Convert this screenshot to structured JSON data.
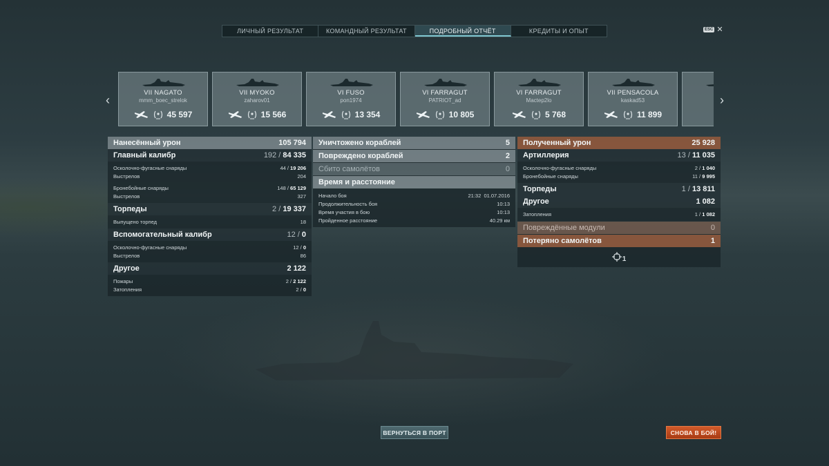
{
  "tabs": [
    {
      "label": "ЛИЧНЫЙ РЕЗУЛЬТАТ",
      "active": false
    },
    {
      "label": "КОМАНДНЫЙ РЕЗУЛЬТАТ",
      "active": false
    },
    {
      "label": "ПОДРОБНЫЙ ОТЧЁТ",
      "active": true
    },
    {
      "label": "КРЕДИТЫ И ОПЫТ",
      "active": false
    }
  ],
  "esc_label": "ESC",
  "cards": [
    {
      "ship": "VII NAGATO",
      "player": "mmm_boec_strelok",
      "score": "45 597"
    },
    {
      "ship": "VII MYOKO",
      "player": "zaharov01",
      "score": "15 566"
    },
    {
      "ship": "VI FUSO",
      "player": "pon1974",
      "score": "13 354"
    },
    {
      "ship": "VI FARRAGUT",
      "player": "PATRIOT_ad",
      "score": "10 805"
    },
    {
      "ship": "VI FARRAGUT",
      "player": "Mactep2lo",
      "score": "5 768"
    },
    {
      "ship": "VII PENSACOLA",
      "player": "kaskad53",
      "score": "11 899"
    },
    {
      "ship": "VI",
      "player": "",
      "score": ""
    }
  ],
  "left": {
    "damage_dealt": {
      "label": "Нанесённый урон",
      "value": "105 794"
    },
    "main_battery": {
      "label": "Главный калибр",
      "hits": "192",
      "value": "84 335"
    },
    "he_shells": {
      "label": "Осколочно-фугасные снаряды",
      "hits": "44",
      "value": "19 206"
    },
    "he_shots": {
      "label": "Выстрелов",
      "value": "204"
    },
    "ap_shells": {
      "label": "Бронебойные снаряды",
      "hits": "148",
      "value": "65 129"
    },
    "ap_shots": {
      "label": "Выстрелов",
      "value": "327"
    },
    "torpedoes": {
      "label": "Торпеды",
      "hits": "2",
      "value": "19 337"
    },
    "torps_launched": {
      "label": "Выпущено торпед",
      "value": "18"
    },
    "secondary": {
      "label": "Вспомогательный калибр",
      "hits": "12",
      "value": "0"
    },
    "sec_he": {
      "label": "Осколочно-фугасные снаряды",
      "hits": "12",
      "value": "0"
    },
    "sec_shots": {
      "label": "Выстрелов",
      "value": "86"
    },
    "other": {
      "label": "Другое",
      "value": "2 122"
    },
    "fires": {
      "label": "Пожары",
      "hits": "2",
      "value": "2 122"
    },
    "floods": {
      "label": "Затопления",
      "hits": "2",
      "value": "0"
    }
  },
  "center": {
    "destroyed": {
      "label": "Уничтожено кораблей",
      "value": "5"
    },
    "damaged": {
      "label": "Повреждено кораблей",
      "value": "2"
    },
    "planes": {
      "label": "Сбито самолётов",
      "value": "0"
    },
    "time_header": "Время и расстояние",
    "battle_start": {
      "label": "Начало боя",
      "time": "21:32",
      "date": "01.07.2016"
    },
    "duration": {
      "label": "Продолжительность боя",
      "value": "10:13"
    },
    "participation": {
      "label": "Время участия в бою",
      "value": "10:13"
    },
    "distance": {
      "label": "Пройденное расстояние",
      "value": "40.29 км"
    }
  },
  "right": {
    "damage_received": {
      "label": "Полученный урон",
      "value": "25 928"
    },
    "artillery": {
      "label": "Артиллерия",
      "hits": "13",
      "value": "11 035"
    },
    "he_shells": {
      "label": "Осколочно-фугасные снаряды",
      "hits": "2",
      "value": "1 040"
    },
    "ap_shells": {
      "label": "Бронебойные снаряды",
      "hits": "11",
      "value": "9 995"
    },
    "torpedoes": {
      "label": "Торпеды",
      "hits": "1",
      "value": "13 811"
    },
    "other": {
      "label": "Другое",
      "value": "1 082"
    },
    "floods": {
      "label": "Затопления",
      "hits": "1",
      "value": "1 082"
    },
    "modules": {
      "label": "Повреждённые модули",
      "value": "0"
    },
    "planes_lost": {
      "label": "Потеряно самолётов",
      "value": "1"
    },
    "spotted": "1"
  },
  "buttons": {
    "port": "ВЕРНУТЬСЯ В ПОРТ",
    "battle": "СНОВА В БОЙ!"
  },
  "icons": [
    "chevron-left-icon",
    "chevron-right-icon",
    "ship-silhouette-icon",
    "plane-icon",
    "wreath-icon",
    "crosshair-icon",
    "close-icon"
  ],
  "colors": {
    "accent_orange": "#c4542a",
    "tab_active": "#2f4950",
    "header_orange": "#965a3c"
  }
}
